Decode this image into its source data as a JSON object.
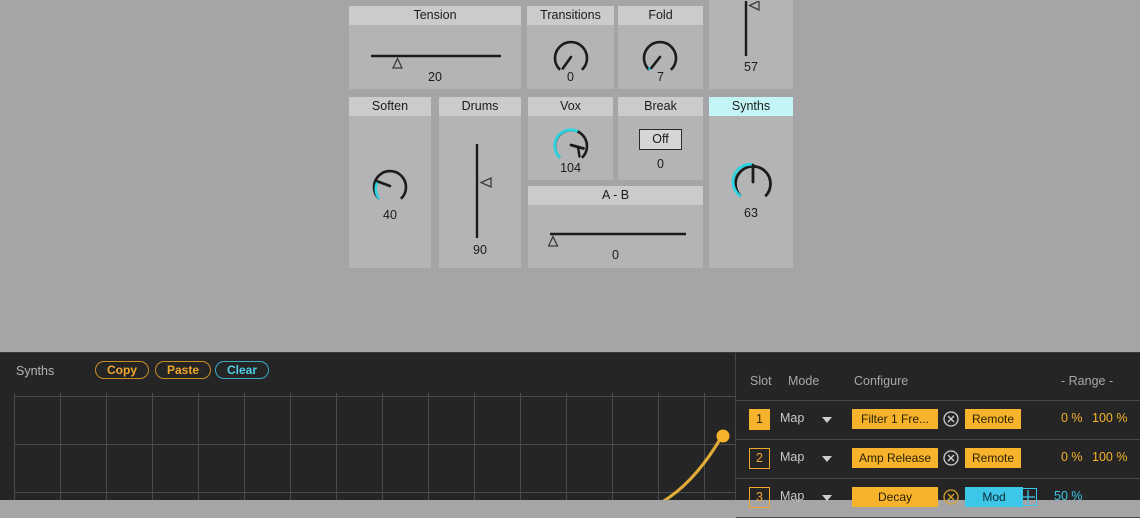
{
  "background_color": "#a5a5a7",
  "rack": {
    "panels": [
      {
        "id": "tension",
        "name": "Tension",
        "title": "Tension",
        "control": "h-slider",
        "value": "20",
        "active": false
      },
      {
        "id": "transitions",
        "name": "Transitions",
        "title": "Transitions",
        "control": "knob",
        "value": "0",
        "active": false
      },
      {
        "id": "fold",
        "name": "Fold",
        "title": "Fold",
        "control": "knob",
        "value": "7",
        "active": false
      },
      {
        "id": "top-right-unnamed",
        "name": "",
        "title": "",
        "control": "v-slider",
        "value": "57",
        "active": false
      },
      {
        "id": "soften",
        "name": "Soften",
        "title": "Soften",
        "control": "knob",
        "value": "40",
        "active": false
      },
      {
        "id": "drums",
        "name": "Drums",
        "title": "Drums",
        "control": "v-slider",
        "value": "90",
        "active": false
      },
      {
        "id": "vox",
        "name": "Vox",
        "title": "Vox",
        "control": "knob",
        "value": "104",
        "active": false
      },
      {
        "id": "break",
        "name": "Break",
        "title": "Break",
        "control": "toggle",
        "toggle_label": "Off",
        "value": "0",
        "active": false
      },
      {
        "id": "synths",
        "name": "Synths",
        "title": "Synths",
        "control": "knob",
        "value": "63",
        "active": true
      },
      {
        "id": "ab",
        "name": "A - B",
        "title": "A - B",
        "control": "h-slider",
        "value": "0",
        "active": false
      }
    ],
    "accent_color": "#2ad4e0",
    "active_header_color": "#c3f5f7"
  },
  "curve_editor": {
    "title": "Synths",
    "buttons": [
      {
        "label": "Copy",
        "style": "orange"
      },
      {
        "label": "Paste",
        "style": "orange"
      },
      {
        "label": "Clear",
        "style": "cyan"
      }
    ],
    "curve_color": "#e8b13a",
    "node_color": "#f7b32b",
    "grid_color": "#4a4a4a",
    "grid_columns": 16,
    "grid_rows": 3
  },
  "slots": {
    "headers": {
      "slot": "Slot",
      "mode": "Mode",
      "configure": "Configure",
      "range": "- Range -"
    },
    "rows": [
      {
        "num": "1",
        "selected": true,
        "mode": "Map",
        "target": "Filter 1 Fre...",
        "badge": "Remote",
        "badge_style": "orange",
        "has_grid_icon": false,
        "range_min": "0 %",
        "range_max": "100 %",
        "range_color": "orange"
      },
      {
        "num": "2",
        "selected": false,
        "mode": "Map",
        "target": "Amp Release",
        "badge": "Remote",
        "badge_style": "orange",
        "has_grid_icon": false,
        "range_min": "0 %",
        "range_max": "100 %",
        "range_color": "orange"
      },
      {
        "num": "3",
        "selected": false,
        "mode": "Map",
        "target": "Decay",
        "badge": "Mod",
        "badge_style": "cyan",
        "has_grid_icon": true,
        "range_min": "50 %",
        "range_max": "",
        "range_color": "cyan"
      }
    ]
  }
}
